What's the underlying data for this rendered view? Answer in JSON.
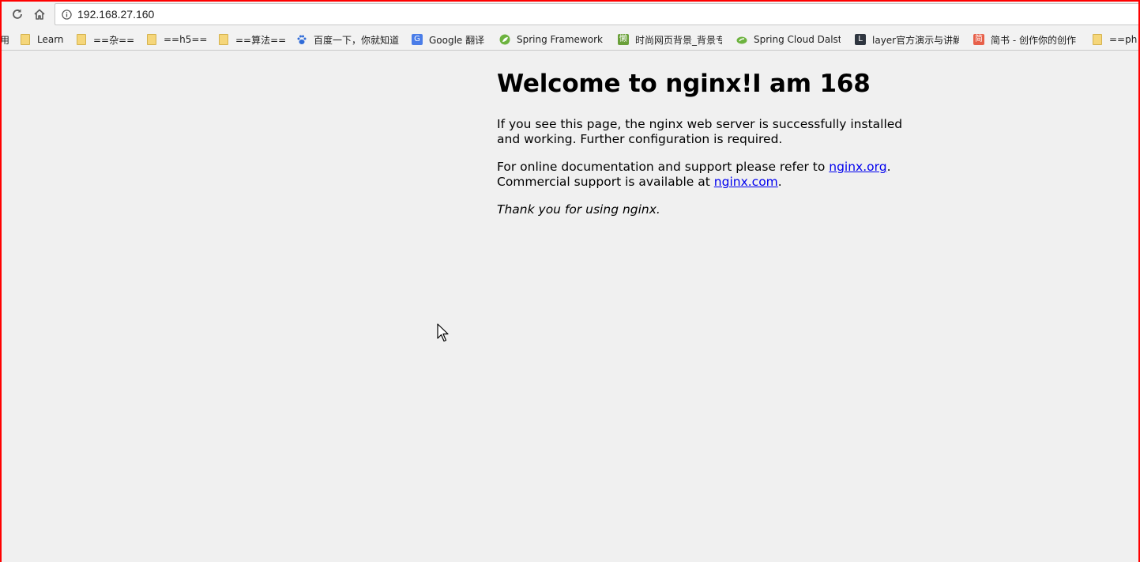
{
  "browser": {
    "url": "192.168.27.160",
    "bookmarks": [
      {
        "label": "用",
        "icon": "none"
      },
      {
        "label": "Learn",
        "icon": "folder-icon"
      },
      {
        "label": "==杂==",
        "icon": "folder-icon"
      },
      {
        "label": "==h5==",
        "icon": "folder-icon"
      },
      {
        "label": "==算法==",
        "icon": "folder-icon"
      },
      {
        "label": "百度一下，你就知道",
        "icon": "baidu-paw-icon"
      },
      {
        "label": "Google 翻译",
        "icon": "google-translate-icon"
      },
      {
        "label": "Spring Framework",
        "icon": "spring-leaf-icon"
      },
      {
        "label": "时尚网页背景_背景专",
        "icon": "lan-icon"
      },
      {
        "label": "Spring Cloud Dalst",
        "icon": "spring-cloud-icon"
      },
      {
        "label": "layer官方演示与讲解",
        "icon": "layer-icon"
      },
      {
        "label": "简书 - 创作你的创作",
        "icon": "jianshu-icon"
      },
      {
        "label": "==ph",
        "icon": "folder-icon"
      }
    ],
    "colors": {
      "frame": "#ff0000",
      "link": "#0000ee",
      "page_bg": "#f0f0f0"
    }
  },
  "page": {
    "title": "Welcome to nginx!I am 168",
    "p1": "If you see this page, the nginx web server is successfully installed and working. Further configuration is required.",
    "p2_prefix": "For online documentation and support please refer to ",
    "link1": "nginx.org",
    "p2_mid": ".",
    "p2_line2": "Commercial support is available at ",
    "link2": "nginx.com",
    "p2_end": ".",
    "thanks": "Thank you for using nginx."
  }
}
